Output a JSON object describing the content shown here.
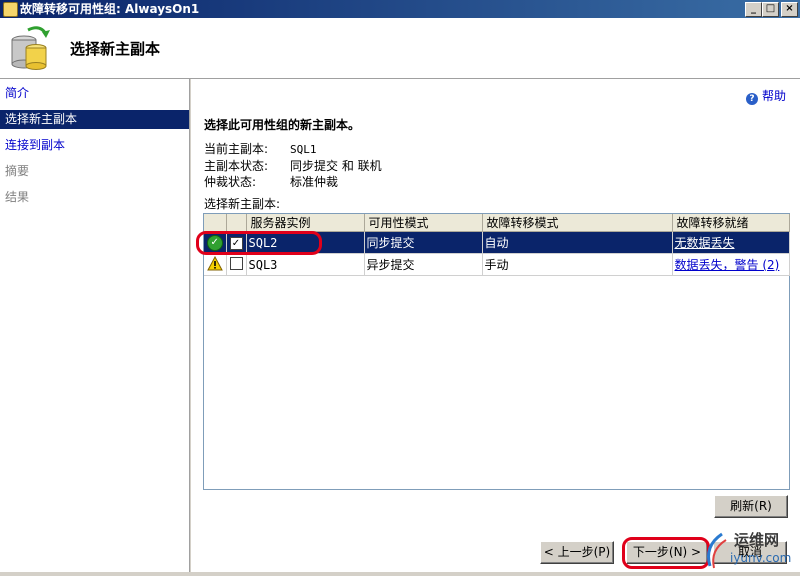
{
  "window": {
    "title": "故障转移可用性组: AlwaysOn1",
    "controls": {
      "minimize": "_",
      "maximize": "□",
      "close": "×"
    }
  },
  "header": {
    "title": "选择新主副本",
    "icon": "database-icon"
  },
  "sidebar": {
    "items": [
      {
        "label": "简介",
        "state": "link"
      },
      {
        "label": "选择新主副本",
        "state": "selected"
      },
      {
        "label": "连接到副本",
        "state": "link"
      },
      {
        "label": "摘要",
        "state": "disabled"
      },
      {
        "label": "结果",
        "state": "disabled"
      }
    ]
  },
  "main": {
    "help_label": "帮助",
    "section_title": "选择此可用性组的新主副本。",
    "info": [
      {
        "label": "当前主副本:",
        "value": "SQL1"
      },
      {
        "label": "主副本状态:",
        "value": "同步提交 和 联机"
      },
      {
        "label": "仲裁状态:",
        "value": "标准仲裁"
      }
    ],
    "select_label": "选择新主副本:",
    "table": {
      "columns": [
        "",
        "",
        "服务器实例",
        "可用性模式",
        "故障转移模式",
        "故障转移就绪"
      ],
      "rows": [
        {
          "status": "ok-icon",
          "checked": true,
          "server": "SQL2",
          "availability": "同步提交",
          "failover": "自动",
          "readiness": "无数据丢失",
          "selected": true
        },
        {
          "status": "warning-icon",
          "checked": false,
          "server": "SQL3",
          "availability": "异步提交",
          "failover": "手动",
          "readiness": "数据丢失，警告 (2)",
          "selected": false
        }
      ]
    },
    "refresh_button": "刷新(R)",
    "back_button": "< 上一步(P)",
    "next_button": "下一步(N) >",
    "cancel_button": "取消"
  },
  "watermark": {
    "text": "运维网",
    "url": "iyunv.com"
  },
  "colors": {
    "title_bar": "#0a246a",
    "selection": "#0a246a",
    "link": "#0000cc",
    "highlight_oval": "#e0001a"
  }
}
